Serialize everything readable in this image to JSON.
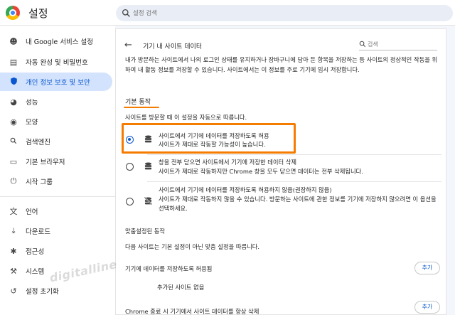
{
  "header": {
    "app_title": "설정",
    "search_placeholder": "설정 검색"
  },
  "sidebar": {
    "items": [
      {
        "label": "내 Google 서비스 설정",
        "icon": "person-icon",
        "glyph": "👤"
      },
      {
        "label": "자동 완성 및 비밀번호",
        "icon": "clipboard-icon",
        "glyph": "📋"
      },
      {
        "label": "개인 정보 보호 및 보안",
        "icon": "shield-icon",
        "glyph": "🛡",
        "active": true
      },
      {
        "label": "성능",
        "icon": "speedometer-icon",
        "glyph": "⏲"
      },
      {
        "label": "모양",
        "icon": "palette-icon",
        "glyph": "🎨"
      },
      {
        "label": "검색엔진",
        "icon": "search-icon",
        "glyph": "🔍"
      },
      {
        "label": "기본 브라우저",
        "icon": "browser-window-icon",
        "glyph": "▭"
      },
      {
        "label": "시작 그룹",
        "icon": "power-icon",
        "glyph": "⏻"
      },
      {
        "label": "언어",
        "icon": "translate-icon",
        "glyph": "文"
      },
      {
        "label": "다운로드",
        "icon": "download-icon",
        "glyph": "⤓"
      },
      {
        "label": "접근성",
        "icon": "accessibility-icon",
        "glyph": "♿"
      },
      {
        "label": "시스템",
        "icon": "wrench-icon",
        "glyph": "🔧"
      },
      {
        "label": "설정 초기화",
        "icon": "reset-icon",
        "glyph": "↺"
      }
    ]
  },
  "main": {
    "page_title": "기기 내 사이트 데이터",
    "search_placeholder": "검색",
    "description": "내가 방문하는 사이트에서 나의 로그인 상태를 유지하거나 장바구니에 담아 둔 항목을 저장하는 등 사이트의 정상적인 작동을 위하여 내 활동 정보를 저장할 수 있습니다. 사이트에서는 이 정보를 주로 기기에 임시 저장합니다.",
    "default_heading": "기본 동작",
    "default_desc": "사이트를 방문할 때 이 설정을 자동으로 따릅니다.",
    "options": [
      {
        "title": "사이트에서 기기에 데이터를 저장하도록 허용",
        "sub": "사이트가 제대로 작동할 가능성이 높습니다.",
        "checked": true
      },
      {
        "title": "창을 전부 닫으면 사이트에서 기기에 저장한 데이터 삭제",
        "sub": "사이트가 제대로 작동하지만 Chrome 창을 모두 닫으면 데이터는 전부 삭제됩니다.",
        "checked": false
      },
      {
        "title": "사이트에서 기기에 데이터를 저장하도록 허용하지 않음(권장하지 않음)",
        "sub": "사이트가 제대로 작동하지 않을 수 있습니다. 방문하는 사이트에 관한 정보를 기기에 저장하지 않으려면 이 옵션을 선택하세요.",
        "checked": false
      }
    ],
    "custom_heading": "맞춤설정된 동작",
    "custom_desc": "다음 사이트는 기본 설정이 아닌 맞춤 설정을 따릅니다.",
    "allow_label": "기기에 데이터를 저장하도록 허용됨",
    "add_label": "추가",
    "no_sites": "추가된 사이트 없음",
    "clear_on_exit_label": "Chrome 종료 시 기기에서 사이트 데이터를 항상 삭제",
    "add_label_2": "추가"
  },
  "watermark": "digitalline",
  "colors": {
    "accent": "#0b57d0",
    "highlight": "#f57c00",
    "active_bg": "#d3e3fd"
  }
}
